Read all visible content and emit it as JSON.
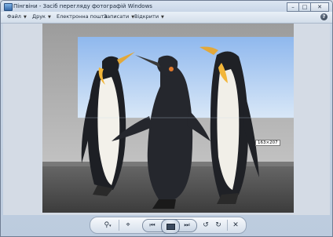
{
  "window": {
    "title": "Пінгвіни - Засіб перегляду фотографій Windows",
    "controls": {
      "minimize": "–",
      "maximize": "□",
      "close": "✕"
    }
  },
  "menu": {
    "items": [
      {
        "label": "Файл"
      },
      {
        "label": "Друк"
      },
      {
        "label": "Електронна пошта"
      },
      {
        "label": "Записати"
      },
      {
        "label": "Відкрити"
      }
    ],
    "help": "?"
  },
  "viewer": {
    "cursor_tooltip": "163×207"
  },
  "toolbar": {
    "zoom_icon": "magnifier-icon",
    "actual_size_icon": "fit-window-icon",
    "previous_icon": "previous-icon",
    "slideshow_icon": "slideshow-icon",
    "next_icon": "next-icon",
    "rotate_ccw_icon": "rotate-counterclockwise-icon",
    "rotate_cw_icon": "rotate-clockwise-icon",
    "delete_icon": "delete-icon"
  },
  "colors": {
    "sky": "#8fb6e8",
    "selection_tint": "#b7d2f2",
    "ground": "#5a5a5a"
  }
}
